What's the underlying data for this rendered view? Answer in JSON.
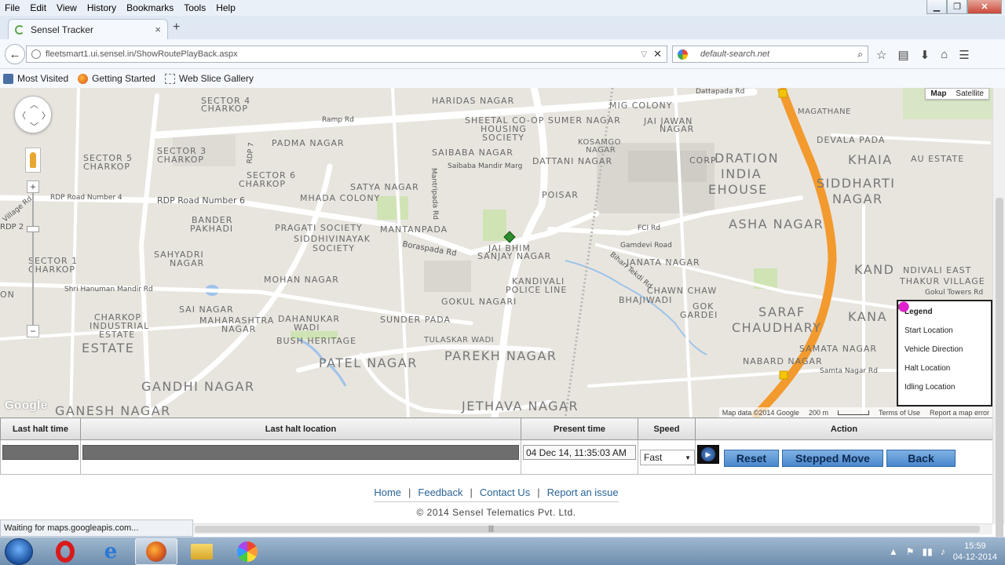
{
  "menu": {
    "items": [
      "File",
      "Edit",
      "View",
      "History",
      "Bookmarks",
      "Tools",
      "Help"
    ]
  },
  "window_buttons": {
    "minimize": "▁",
    "maximize": "❐",
    "close": "✕"
  },
  "tab": {
    "title": "Sensel Tracker",
    "close": "×",
    "new_tab": "+"
  },
  "navbar": {
    "url": "fleetsmart1.ui.sensel.in/ShowRoutePlayBack.aspx",
    "search_placeholder": "default-search.net",
    "back_icon": "←",
    "icons": [
      "star-icon",
      "reading-list-icon",
      "download-icon",
      "home-icon",
      "menu-icon"
    ]
  },
  "bookmarks": [
    {
      "label": "Most Visited",
      "icon": "most-visited-icon"
    },
    {
      "label": "Getting Started",
      "icon": "firefox-icon"
    },
    {
      "label": "Web Slice Gallery",
      "icon": "web-slice-icon"
    }
  ],
  "map": {
    "type_buttons": [
      "Map",
      "Satellite"
    ],
    "zoom_in": "+",
    "zoom_out": "−",
    "google_logo": "Google",
    "attribution": [
      "Map data ©2014 Google",
      "200 m",
      "Terms of Use",
      "Report a map error"
    ],
    "labels": [
      {
        "text": "HARIDAS NAGAR",
        "size": "m"
      },
      {
        "text": "SECTOR 4",
        "size": "m"
      },
      {
        "text": "CHARKOP",
        "size": "m"
      },
      {
        "text": "Ramp Rd",
        "size": "rd"
      },
      {
        "text": "SHEETAL CO-OP SUMER NAGAR",
        "size": "m"
      },
      {
        "text": "HOUSING",
        "size": "m"
      },
      {
        "text": "SOCIETY",
        "size": "m"
      },
      {
        "text": "MIG COLONY",
        "size": "m"
      },
      {
        "text": "JAI JAWAN",
        "size": "m"
      },
      {
        "text": "NAGAR",
        "size": "m"
      },
      {
        "text": "Dattapada Rd",
        "size": "rd"
      },
      {
        "text": "MAGATHANE",
        "size": "s"
      },
      {
        "text": "PADMA NAGAR",
        "size": "m"
      },
      {
        "text": "SAIBABA NAGAR",
        "size": "m"
      },
      {
        "text": "Saibaba Mandir Marg",
        "size": "rd"
      },
      {
        "text": "KOSAMGO",
        "size": "s"
      },
      {
        "text": "NAGAR",
        "size": "s"
      },
      {
        "text": "DATTANI NAGAR",
        "size": "m"
      },
      {
        "text": "DEVALA PADA",
        "size": "m"
      },
      {
        "text": "SECTOR 5",
        "size": "m"
      },
      {
        "text": "CHARKOP",
        "size": "m"
      },
      {
        "text": "SECTOR 3",
        "size": "m"
      },
      {
        "text": "CHARKOP",
        "size": "m"
      },
      {
        "text": "RDP 7",
        "size": "rd"
      },
      {
        "text": "Mantripada Rd",
        "size": "rd"
      },
      {
        "text": "SECTOR 6",
        "size": "m"
      },
      {
        "text": "CHARKOP",
        "size": "m"
      },
      {
        "text": "SATYA NAGAR",
        "size": "m"
      },
      {
        "text": "KHAIA",
        "size": "l"
      },
      {
        "text": "AU ESTATE",
        "size": "m"
      },
      {
        "text": "CORP",
        "size": "m"
      },
      {
        "text": "DRATION",
        "size": "l"
      },
      {
        "text": "INDIA",
        "size": "l"
      },
      {
        "text": "EHOUSE",
        "size": "l"
      },
      {
        "text": "SIDDHARTI",
        "size": "l"
      },
      {
        "text": "NAGAR",
        "size": "l"
      },
      {
        "text": "RDP Road Number 4",
        "size": "rd"
      },
      {
        "text": "RDP Road Number 6",
        "size": "rd"
      },
      {
        "text": "MHADA COLONY",
        "size": "m"
      },
      {
        "text": "POISAR",
        "size": "m"
      },
      {
        "text": "ASHA NAGAR",
        "size": "l"
      },
      {
        "text": "BANDER",
        "size": "m"
      },
      {
        "text": "PAKHADI",
        "size": "m"
      },
      {
        "text": "MANTANPADA",
        "size": "m"
      },
      {
        "text": "FCI Rd",
        "size": "rd"
      },
      {
        "text": "PRAGATI SOCIETY",
        "size": "m"
      },
      {
        "text": "SIDDHIVINAYAK",
        "size": "m"
      },
      {
        "text": "SOCIETY",
        "size": "m"
      },
      {
        "text": "Boraspada Rd",
        "size": "rd"
      },
      {
        "text": "JAI BHIM",
        "size": "m"
      },
      {
        "text": "SANJAY NAGAR",
        "size": "m"
      },
      {
        "text": "Gamdevi Road",
        "size": "rd"
      },
      {
        "text": "SAHYADRI",
        "size": "m"
      },
      {
        "text": "NAGAR",
        "size": "m"
      },
      {
        "text": "JANATA NAGAR",
        "size": "m"
      },
      {
        "text": "KAND",
        "size": "l"
      },
      {
        "text": "NDIVALI EAST",
        "size": "m"
      },
      {
        "text": "THAKUR VILLAGE",
        "size": "m"
      },
      {
        "text": "SECTOR 1",
        "size": "m"
      },
      {
        "text": "CHARKOP",
        "size": "m"
      },
      {
        "text": "MOHAN NAGAR",
        "size": "m"
      },
      {
        "text": "KANDIVALI",
        "size": "m"
      },
      {
        "text": "POLICE LINE",
        "size": "m"
      },
      {
        "text": "Bihari Tekdi Rd",
        "size": "rd"
      },
      {
        "text": "CHAWN CHAW",
        "size": "m"
      },
      {
        "text": "Gokul Towers Rd",
        "size": "rd"
      },
      {
        "text": "Shri Hanuman Mandir Rd",
        "size": "rd"
      },
      {
        "text": "GOKUL NAGARI",
        "size": "m"
      },
      {
        "text": "BHAJIWADI",
        "size": "m"
      },
      {
        "text": "SAI NAGAR",
        "size": "m"
      },
      {
        "text": "GOK",
        "size": "m"
      },
      {
        "text": "GARDEI",
        "size": "m"
      },
      {
        "text": "SARAF",
        "size": "l"
      },
      {
        "text": "CHAUDHARY",
        "size": "l"
      },
      {
        "text": "MAHARASHTRA",
        "size": "m"
      },
      {
        "text": "NAGAR",
        "size": "m"
      },
      {
        "text": "DAHANUKAR",
        "size": "m"
      },
      {
        "text": "WADI",
        "size": "m"
      },
      {
        "text": "SUNDER PADA",
        "size": "m"
      },
      {
        "text": "KANA",
        "size": "l"
      },
      {
        "text": "CHARKOP",
        "size": "m"
      },
      {
        "text": "INDUSTRIAL",
        "size": "m"
      },
      {
        "text": "ESTATE",
        "size": "m"
      },
      {
        "text": "ESTATE",
        "size": "l"
      },
      {
        "text": "BUSH HERITAGE",
        "size": "m"
      },
      {
        "text": "TULASKAR WADI",
        "size": "s"
      },
      {
        "text": "SAMATA NAGAR",
        "size": "m"
      },
      {
        "text": "PATEL NAGAR",
        "size": "l"
      },
      {
        "text": "PAREKH NAGAR",
        "size": "l"
      },
      {
        "text": "NABARD NAGAR",
        "size": "m"
      },
      {
        "text": "Samta Nagar Rd",
        "size": "rd"
      },
      {
        "text": "GANDHI NAGAR",
        "size": "l"
      },
      {
        "text": "GANESH NAGAR",
        "size": "l"
      },
      {
        "text": "JETHAVA NAGAR",
        "size": "l"
      },
      {
        "text": "ON",
        "size": "m"
      },
      {
        "text": "RDP 2",
        "size": "rd"
      },
      {
        "text": "Village Rd",
        "size": "rd"
      }
    ]
  },
  "legend": {
    "title": "Legend",
    "items": [
      {
        "label": "Start Location",
        "icon": "green-diamond-icon",
        "color": "#2e8b2e"
      },
      {
        "label": "Vehicle Direction",
        "icon": "green-arrow-icon",
        "color": "#1f8f1f"
      },
      {
        "label": "Halt Location",
        "icon": "red-dot-icon",
        "color": "#e0141e"
      },
      {
        "label": "Idling Location",
        "icon": "magenta-dot-icon",
        "color": "#e020d0"
      }
    ]
  },
  "table": {
    "headers": [
      "Last halt time",
      "Last halt location",
      "Present time",
      "Speed",
      "Action"
    ],
    "present_time": "04 Dec 14, 11:35:03 AM",
    "speed": "Fast",
    "buttons": {
      "reset": "Reset",
      "stepped": "Stepped Move",
      "back": "Back"
    }
  },
  "footer": {
    "links": [
      "Home",
      "Feedback",
      "Contact Us",
      "Report an issue"
    ],
    "separator": "|",
    "copyright": "© 2014 Sensel Telematics Pvt. Ltd."
  },
  "status": "Waiting for maps.googleapis.com...",
  "taskbar": {
    "time": "15:59",
    "date": "04-12-2014",
    "apps": [
      "opera-icon",
      "internet-explorer-icon",
      "firefox-icon",
      "explorer-folder-icon",
      "pinwheel-app-icon"
    ]
  },
  "colors": {
    "highway": "#f29a2e",
    "road": "#ffffff",
    "park": "#cfe3b4",
    "water": "#9ec3ea",
    "button_blue": "#5b94d3"
  }
}
